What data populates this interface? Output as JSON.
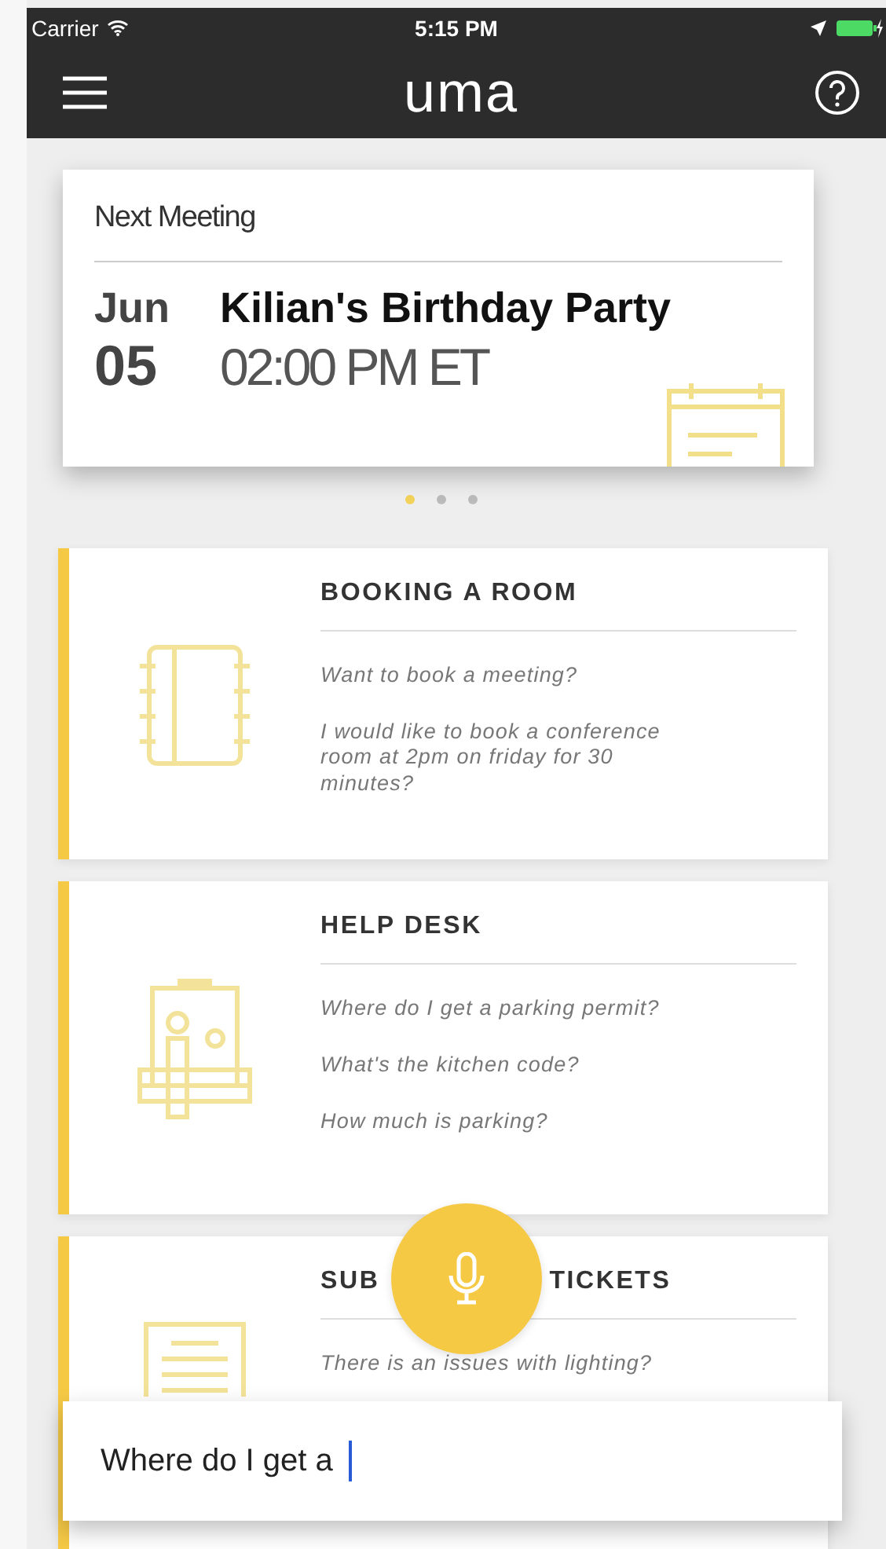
{
  "status_bar": {
    "carrier": "Carrier",
    "time": "5:15 PM"
  },
  "app_bar": {
    "logo": "uma"
  },
  "next_meeting": {
    "heading": "Next Meeting",
    "month": "Jun",
    "day": "05",
    "title": "Kilian's Birthday Party",
    "time": "02:00 PM ET"
  },
  "pager": [
    {
      "selected": true
    },
    {
      "selected": false
    },
    {
      "selected": false
    }
  ],
  "sections": [
    {
      "kind": "notebook",
      "title_parts": [
        "BOOKING A ROOM"
      ],
      "questions": [
        "Want to book a meeting?",
        "I would like to book a conference room at 2pm on friday for 30 minutes?"
      ]
    },
    {
      "kind": "desk",
      "title_parts": [
        "HELP DESK"
      ],
      "questions": [
        "Where do I get a parking permit?",
        "What's the kitchen code?",
        "How much is parking?"
      ]
    },
    {
      "kind": "document",
      "title_parts": [
        "SUB",
        "TICKETS"
      ],
      "questions": [
        "There is an issues with lighting?"
      ]
    }
  ],
  "query": {
    "value": "Where do I get a"
  }
}
